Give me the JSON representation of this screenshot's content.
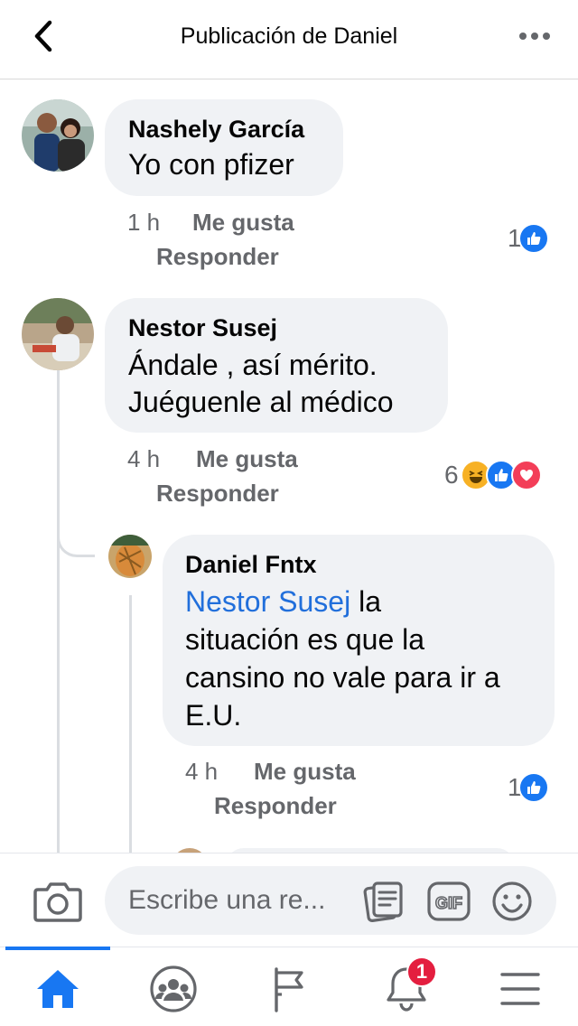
{
  "header": {
    "title": "Publicación de Daniel"
  },
  "comments": [
    {
      "author": "Nashely García",
      "text": "Yo con pfizer",
      "time": "1 h",
      "like_label": "Me gusta",
      "reply_label": "Responder",
      "reaction_count": "1",
      "reactions": [
        "like-icon"
      ]
    },
    {
      "author": "Nestor Susej",
      "text_line1": "Ándale , así mérito.",
      "text_line2": "Juéguenle al médico",
      "time": "4 h",
      "like_label": "Me gusta",
      "reply_label": "Responder",
      "reaction_count": "6",
      "reactions": [
        "haha-icon",
        "like-icon",
        "love-icon"
      ]
    }
  ],
  "replies": [
    {
      "author": "Daniel Fntx",
      "mention": "Nestor Susej",
      "text_line1": " la",
      "text_line2": "situación es que la",
      "text_line3": "cansino no vale para ir a",
      "text_line4": "E.U.",
      "time": "4 h",
      "like_label": "Me gusta",
      "reply_label": "Responder",
      "reaction_count": "1",
      "reactions": [
        "like-icon"
      ]
    }
  ],
  "composer": {
    "placeholder": "Escribe una re..."
  },
  "tabs": [
    {
      "name": "home-icon",
      "active": true
    },
    {
      "name": "groups-icon"
    },
    {
      "name": "pages-flag-icon"
    },
    {
      "name": "notifications-bell-icon",
      "badge": "1"
    },
    {
      "name": "menu-icon"
    }
  ],
  "colors": {
    "accent": "#1877f2",
    "mention": "#216fdb",
    "bubble": "#f0f2f5",
    "muted": "#65676b",
    "badge": "#e41e3f"
  }
}
